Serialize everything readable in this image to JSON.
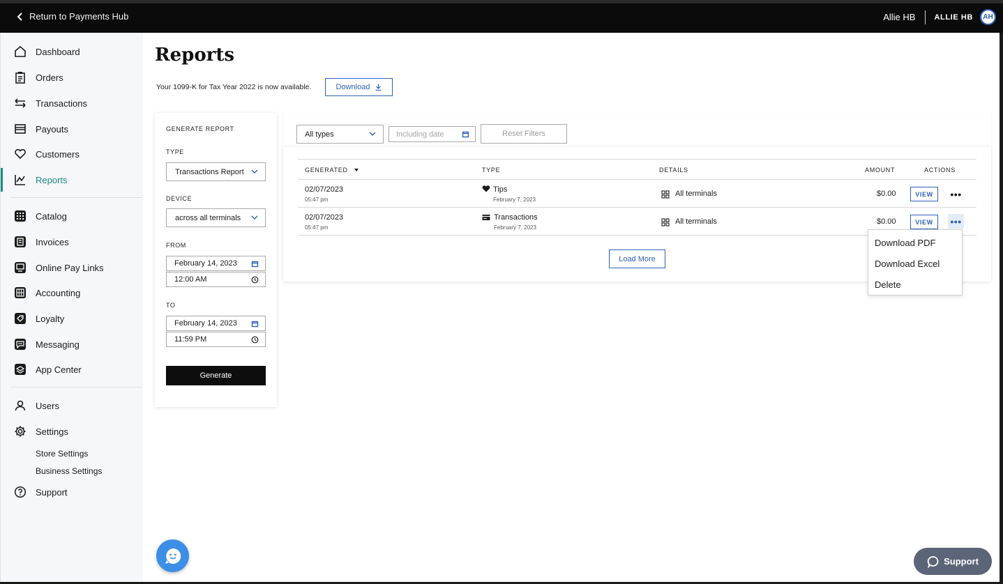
{
  "topbar": {
    "back_label": "Return to Payments Hub",
    "user_name": "Allie HB",
    "merchant_name": "ALLIE HB",
    "avatar_initials": "AH"
  },
  "sidebar": {
    "items": [
      {
        "label": "Dashboard",
        "icon": "home-icon"
      },
      {
        "label": "Orders",
        "icon": "clipboard-icon"
      },
      {
        "label": "Transactions",
        "icon": "arrows-swap-icon"
      },
      {
        "label": "Payouts",
        "icon": "card-icon"
      },
      {
        "label": "Customers",
        "icon": "heart-icon"
      },
      {
        "label": "Reports",
        "icon": "chart-icon",
        "active": true
      },
      {
        "label": "Catalog",
        "icon": "grid-icon"
      },
      {
        "label": "Invoices",
        "icon": "invoice-icon"
      },
      {
        "label": "Online Pay Links",
        "icon": "monitor-icon"
      },
      {
        "label": "Accounting",
        "icon": "calculator-icon"
      },
      {
        "label": "Loyalty",
        "icon": "tag-icon"
      },
      {
        "label": "Messaging",
        "icon": "message-icon"
      },
      {
        "label": "App Center",
        "icon": "layers-icon"
      },
      {
        "label": "Users",
        "icon": "user-icon"
      },
      {
        "label": "Settings",
        "icon": "gear-icon"
      },
      {
        "label": "Support",
        "icon": "question-icon"
      }
    ],
    "settings_sub": [
      "Store Settings",
      "Business Settings"
    ]
  },
  "main": {
    "title": "Reports",
    "tax_note": "Your 1099-K for Tax Year 2022 is now available.",
    "download_label": "Download"
  },
  "generate": {
    "heading": "GENERATE REPORT",
    "type_label": "TYPE",
    "type_value": "Transactions Report",
    "device_label": "DEVICE",
    "device_value": "across all terminals",
    "from_label": "FROM",
    "from_date": "February 14, 2023",
    "from_time": "12:00 AM",
    "to_label": "TO",
    "to_date": "February 14, 2023",
    "to_time": "11:59 PM",
    "generate_label": "Generate"
  },
  "filters": {
    "type_value": "All types",
    "date_placeholder": "Including date",
    "reset_label": "Reset Filters"
  },
  "table": {
    "headers": {
      "generated": "GENERATED",
      "type": "TYPE",
      "details": "DETAILS",
      "amount": "AMOUNT",
      "actions": "ACTIONS"
    },
    "rows": [
      {
        "date": "02/07/2023",
        "time": "05:47 pm",
        "type": "Tips",
        "type_icon": "heart-icon",
        "type_date": "February 7, 2023",
        "details": "All terminals",
        "amount": "$0.00",
        "view": "VIEW"
      },
      {
        "date": "02/07/2023",
        "time": "05:47 pm",
        "type": "Transactions",
        "type_icon": "card-icon",
        "type_date": "February 7, 2023",
        "details": "All terminals",
        "amount": "$0.00",
        "view": "VIEW"
      }
    ],
    "load_more_label": "Load More"
  },
  "menu": {
    "items": [
      "Download PDF",
      "Download Excel",
      "Delete"
    ]
  },
  "support_label": "Support",
  "colors": {
    "accent_teal": "#1e8a7e",
    "link_blue": "#2f5fb8",
    "topbar": "#0b0b0b",
    "support_pill": "#5c6577",
    "chat_bubble": "#3d8ee6"
  }
}
